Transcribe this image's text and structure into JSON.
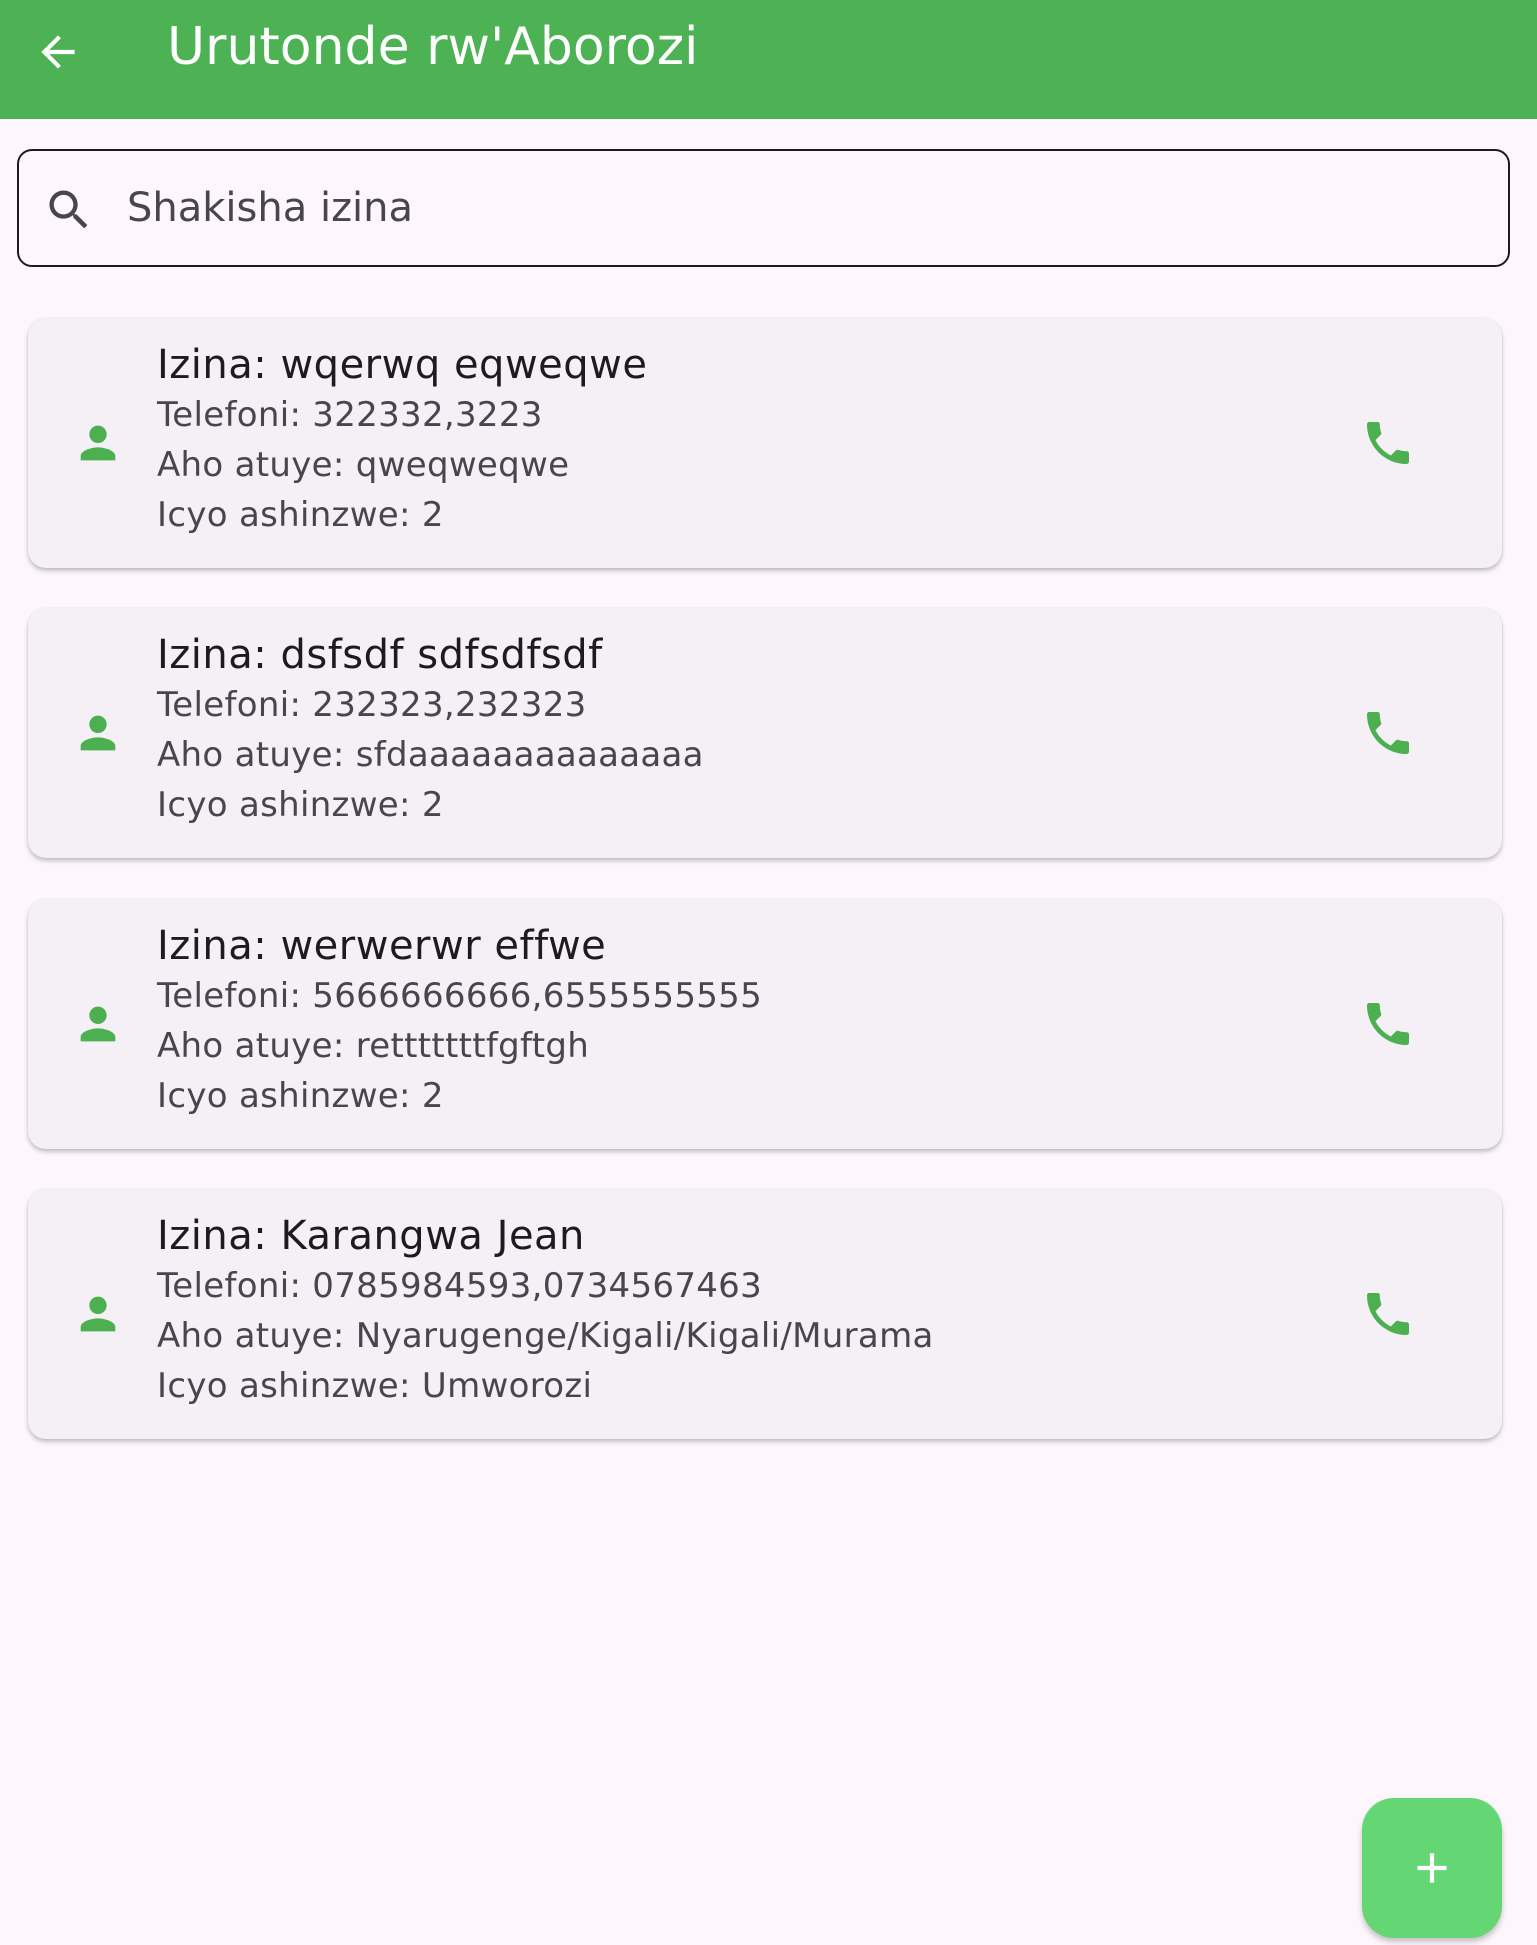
{
  "colors": {
    "app_bar": "#4cb253",
    "accent_icon": "#4caf50",
    "fab": "#64d673",
    "background": "#fdf7fd",
    "card": "#f4f0f6"
  },
  "app_bar": {
    "back_icon": "arrow-back-icon",
    "title": "Urutonde rw'Aborozi"
  },
  "search": {
    "icon": "search-icon",
    "value": "",
    "placeholder": "Shakisha izina"
  },
  "farmers": [
    {
      "name": "Izina: wqerwq eqweqwe",
      "phone": "Telefoni: 322332,3223",
      "location": "Aho atuye: qweqweqwe",
      "role": "Icyo ashinzwe: 2"
    },
    {
      "name": "Izina: dsfsdf sdfsdfsdf",
      "phone": "Telefoni: 232323,232323",
      "location": "Aho atuye: sfdaaaaaaaaaaaaaa",
      "role": "Icyo ashinzwe: 2"
    },
    {
      "name": "Izina: werwerwr effwe",
      "phone": "Telefoni: 5666666666,6555555555",
      "location": "Aho atuye: retttttttfgftgh",
      "role": "Icyo ashinzwe: 2"
    },
    {
      "name": "Izina: Karangwa Jean",
      "phone": "Telefoni: 0785984593,0734567463",
      "location": "Aho atuye: Nyarugenge/Kigali/Kigali/Murama",
      "role": "Icyo ashinzwe: Umworozi"
    }
  ],
  "icons": {
    "card_leading": "person-icon",
    "card_trailing": "phone-icon",
    "fab": "plus-icon"
  }
}
